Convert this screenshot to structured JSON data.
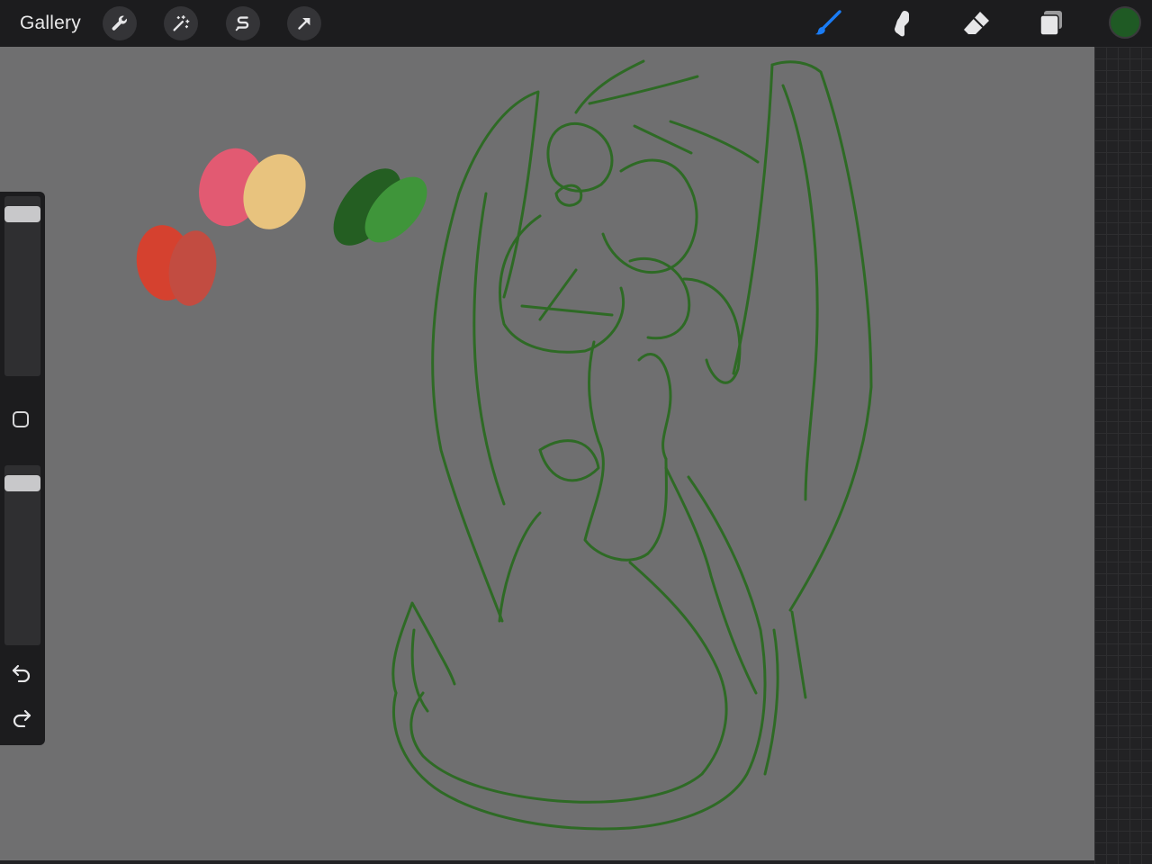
{
  "topbar": {
    "gallery_label": "Gallery",
    "left_tools": [
      {
        "icon": "wrench-icon",
        "name": "actions"
      },
      {
        "icon": "magic-wand-icon",
        "name": "adjustments"
      },
      {
        "icon": "selection-s-icon",
        "name": "selection"
      },
      {
        "icon": "arrow-cursor-icon",
        "name": "transform"
      }
    ],
    "right_tools": [
      {
        "icon": "brush-icon",
        "name": "paint",
        "active": true
      },
      {
        "icon": "smudge-icon",
        "name": "smudge"
      },
      {
        "icon": "eraser-icon",
        "name": "eraser"
      },
      {
        "icon": "layers-icon",
        "name": "layers"
      }
    ],
    "current_color": "#1f5a24"
  },
  "colors": {
    "accent": "#1a7cf5",
    "chrome": "#1c1c1e",
    "canvas": "#6f6f70",
    "sketch_stroke": "#2e6a25"
  },
  "palette_swatches": [
    {
      "color": "#e25a72"
    },
    {
      "color": "#e8c37e"
    },
    {
      "color": "#d5412f"
    },
    {
      "color": "#c24c41"
    },
    {
      "color": "#245e22"
    },
    {
      "color": "#3f953a"
    }
  ],
  "sidebar": {
    "brush_size_level": 0.95,
    "opacity_level": 0.95,
    "undo_icon": "undo-arrow-icon",
    "redo_icon": "redo-arrow-icon"
  }
}
